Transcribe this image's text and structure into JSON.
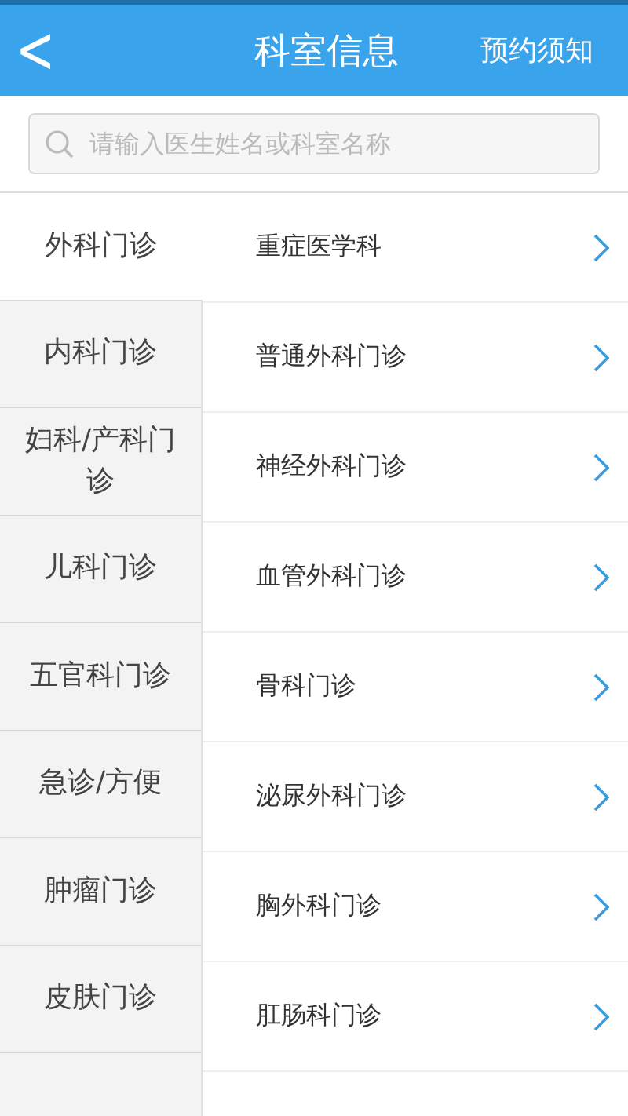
{
  "header": {
    "back": "<",
    "title": "科室信息",
    "action": "预约须知"
  },
  "search": {
    "placeholder": "请输入医生姓名或科室名称"
  },
  "categories": [
    {
      "label": "外科门诊",
      "selected": true
    },
    {
      "label": "内科门诊",
      "selected": false
    },
    {
      "label": "妇科/产科门诊",
      "selected": false
    },
    {
      "label": "儿科门诊",
      "selected": false
    },
    {
      "label": "五官科门诊",
      "selected": false
    },
    {
      "label": "急诊/方便",
      "selected": false
    },
    {
      "label": "肿瘤门诊",
      "selected": false
    },
    {
      "label": "皮肤门诊",
      "selected": false
    }
  ],
  "departments": [
    {
      "name": "重症医学科"
    },
    {
      "name": "普通外科门诊"
    },
    {
      "name": "神经外科门诊"
    },
    {
      "name": "血管外科门诊"
    },
    {
      "name": "骨科门诊"
    },
    {
      "name": "泌尿外科门诊"
    },
    {
      "name": "胸外科门诊"
    },
    {
      "name": "肛肠科门诊"
    }
  ]
}
